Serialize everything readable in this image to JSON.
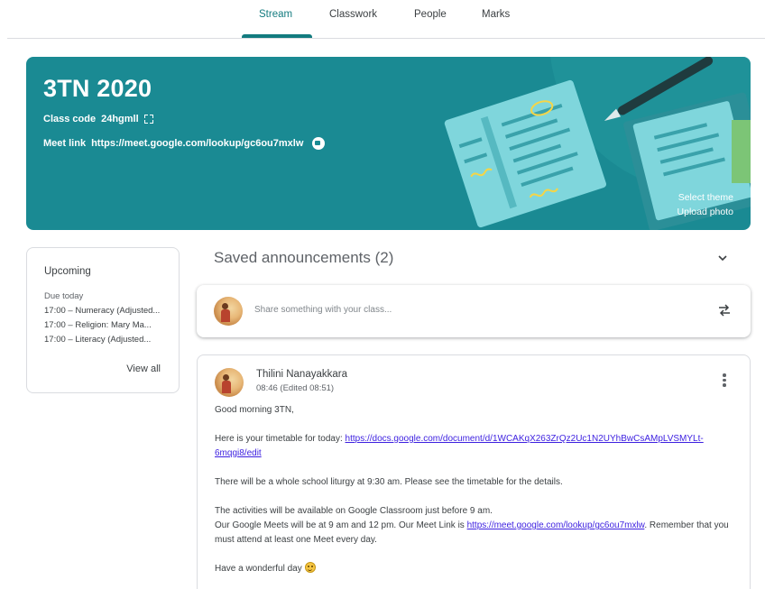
{
  "tabs": [
    {
      "label": "Stream",
      "active": true
    },
    {
      "label": "Classwork",
      "active": false
    },
    {
      "label": "People",
      "active": false
    },
    {
      "label": "Marks",
      "active": false
    }
  ],
  "banner": {
    "title": "3TN 2020",
    "class_code_label": "Class code",
    "class_code": "24hgmll",
    "meet_link_label": "Meet link",
    "meet_link": "https://meet.google.com/lookup/gc6ou7mxlw",
    "select_theme": "Select theme",
    "upload_photo": "Upload photo",
    "color": "#1a8a93"
  },
  "upcoming": {
    "title": "Upcoming",
    "due_label": "Due today",
    "items": [
      "17:00 – Numeracy (Adjusted...",
      "17:00 – Religion: Mary Ma...",
      "17:00 – Literacy (Adjusted..."
    ],
    "view_all": "View all"
  },
  "saved_announcements": "Saved announcements (2)",
  "share": {
    "placeholder": "Share something with your class..."
  },
  "post": {
    "author": "Thilini Nanayakkara",
    "time": "08:46 (Edited 08:51)",
    "greeting": "Good morning 3TN,",
    "timetable_text": "Here is your timetable for today: ",
    "timetable_link": "https://docs.google.com/document/d/1WCAKqX263ZrQz2Uc1N2UYhBwCsAMpLVSMYLt-6mqgi8/edit",
    "liturgy": "There will be a whole school liturgy at 9:30 am. Please see the timetable for the details.",
    "activities": "The activities will be available on Google Classroom just before 9 am.",
    "meets_text": "Our Google Meets will be at 9 am and 12 pm. Our Meet Link is ",
    "meets_link": "https://meet.google.com/lookup/gc6ou7mxlw",
    "meets_after": ". Remember that you must attend at least one Meet every day.",
    "closing": "Have a wonderful day "
  },
  "accent_color": "#137b7f"
}
